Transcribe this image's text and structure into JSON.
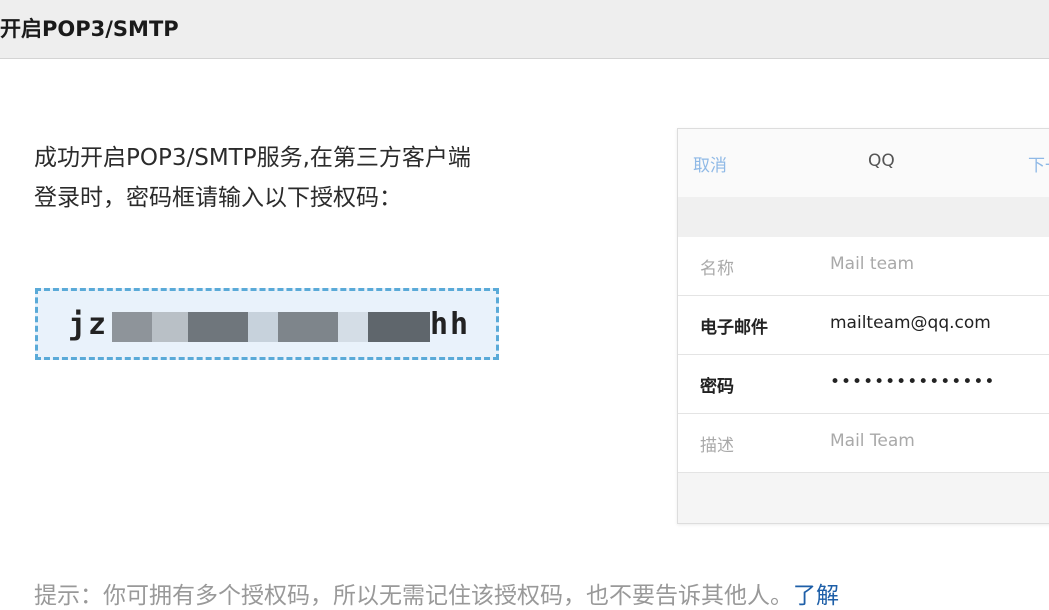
{
  "dialog": {
    "title": "开启POP3/SMTP"
  },
  "instruction": {
    "line1": "成功开启POP3/SMTP服务,在第三方客户端",
    "line2": "登录时，密码框请输入以下授权码："
  },
  "auth_code": {
    "visible_prefix": "jz",
    "visible_suffix": "hh",
    "obscured": true
  },
  "phone_example": {
    "nav": {
      "cancel": "取消",
      "title": "QQ",
      "next": "下一步"
    },
    "rows": [
      {
        "label": "名称",
        "value": "Mail team"
      },
      {
        "label": "电子邮件",
        "value": "mailteam@qq.com"
      },
      {
        "label": "密码",
        "value": "•••••••••••••••"
      },
      {
        "label": "描述",
        "value": "Mail Team"
      }
    ]
  },
  "hint": {
    "text": "提示：你可拥有多个授权码，所以无需记住该授权码，也不要告诉其他人。",
    "link": "了解"
  },
  "colors": {
    "link": "#1e5fa8",
    "code_border": "#5aaad8",
    "code_background": "#e9f2fb"
  }
}
